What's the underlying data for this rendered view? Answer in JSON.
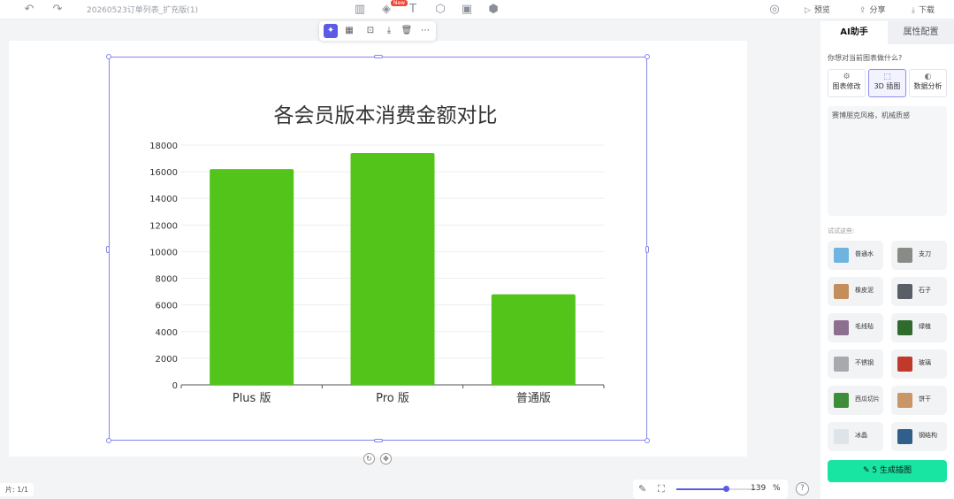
{
  "topbar": {
    "doc_title": "20260523订单列表_扩充版(1)",
    "new_badge": "New",
    "preview_label": "预览",
    "share_label": "分享",
    "download_label": "下载"
  },
  "chart_data": {
    "type": "bar",
    "title": "各会员版本消费金额对比",
    "categories": [
      "Plus 版",
      "Pro 版",
      "普通版"
    ],
    "values": [
      16200,
      17400,
      6800
    ],
    "ylim": [
      0,
      18000
    ],
    "yticks": [
      0,
      2000,
      4000,
      6000,
      8000,
      10000,
      12000,
      14000,
      16000,
      18000
    ],
    "ytick_labels": [
      "0",
      "2000",
      "4000",
      "6000",
      "8000",
      "10000",
      "12000",
      "14000",
      "16000",
      "18000"
    ],
    "grid": true,
    "bar_color": "#52c41a"
  },
  "canvas": {
    "page_indicator": "片: 1/1"
  },
  "zoom": {
    "value": "139",
    "unit": "%",
    "level_fraction": 0.62
  },
  "panel": {
    "tab_ai": "AI助手",
    "tab_props": "属性配置",
    "question": "你想对当前图表做什么?",
    "modes": [
      {
        "label": "图表修改",
        "icon": "chart-edit-icon"
      },
      {
        "label": "3D 插图",
        "icon": "cube-3d-icon"
      },
      {
        "label": "数据分析",
        "icon": "analysis-icon"
      }
    ],
    "prompt_text": "赛博朋克风格，机械质感",
    "section_label": "试试这些:",
    "materials": [
      {
        "label": "普通水",
        "color": "#6fb3e0"
      },
      {
        "label": "支刀",
        "color": "#8a8a86"
      },
      {
        "label": "橡皮泥",
        "color": "#c58d5a"
      },
      {
        "label": "石子",
        "color": "#5a5e66"
      },
      {
        "label": "毛线毡",
        "color": "#8d6f8f"
      },
      {
        "label": "绿植",
        "color": "#2f6b2c"
      },
      {
        "label": "不锈钢",
        "color": "#a8a9ad"
      },
      {
        "label": "玻璃",
        "color": "#c0392b"
      },
      {
        "label": "西瓜切片",
        "color": "#3e8d3a"
      },
      {
        "label": "饼干",
        "color": "#c99666"
      },
      {
        "label": "冰晶",
        "color": "#dfe4ea"
      },
      {
        "label": "钢结构",
        "color": "#2f5f8a"
      }
    ],
    "generate_label": "5  生成插图"
  }
}
